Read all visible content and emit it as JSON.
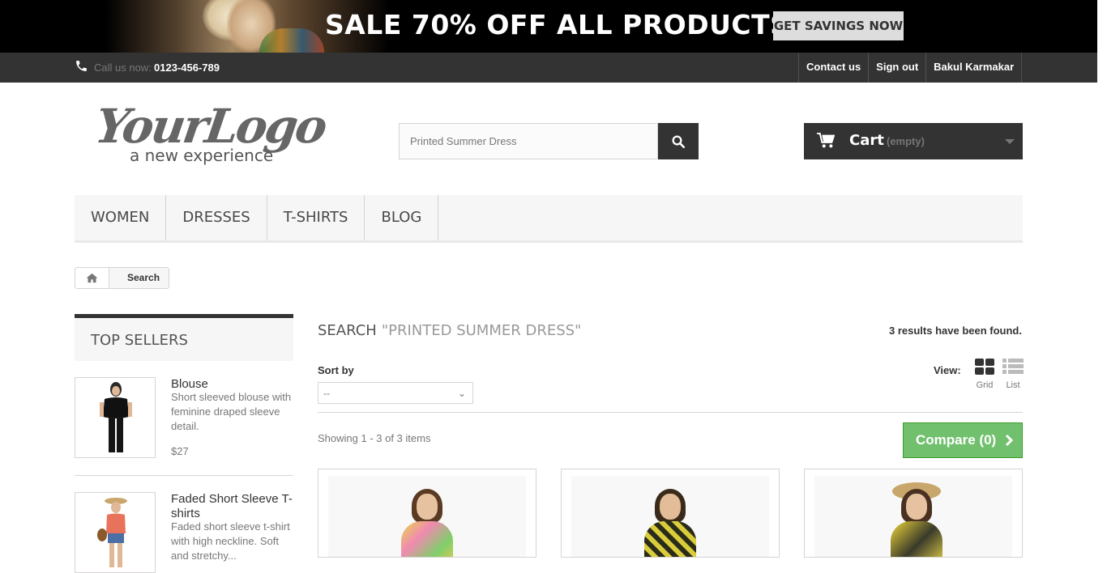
{
  "banner": {
    "headline": "SALE 70% OFF ALL PRODUCTS",
    "cta": "GET SAVINGS NOW"
  },
  "topbar": {
    "call_label": "Call us now:",
    "phone": "0123-456-789",
    "links": [
      "Contact us",
      "Sign out",
      "Bakul Karmakar"
    ]
  },
  "logo": {
    "main": "YourLogo",
    "tagline": "a new experience"
  },
  "search": {
    "value": "Printed Summer Dress"
  },
  "cart": {
    "label": "Cart",
    "status": "(empty)"
  },
  "menu": [
    "WOMEN",
    "DRESSES",
    "T-SHIRTS",
    "BLOG"
  ],
  "breadcrumb": {
    "current": "Search"
  },
  "sidebar": {
    "title": "TOP SELLERS",
    "items": [
      {
        "name": "Blouse",
        "description": "Short sleeved blouse with feminine draped sleeve detail.",
        "price": "$27"
      },
      {
        "name": "Faded Short Sleeve T-shirts",
        "description": "Faded short sleeve t-shirt with high neckline. Soft and stretchy..."
      }
    ]
  },
  "results": {
    "heading": "SEARCH",
    "query": "\"PRINTED SUMMER DRESS\"",
    "count": "3 results have been found.",
    "sort_label": "Sort by",
    "sort_value": "--",
    "view_label": "View:",
    "view_grid": "Grid",
    "view_list": "List",
    "showing": "Showing 1 - 3 of 3 items",
    "compare": "Compare (0)"
  },
  "colors": {
    "banner_bg": "#000000",
    "topbar_bg": "#333333",
    "dark_button": "#333333",
    "compare_green": "#71c06e",
    "menu_bg": "#f6f6f6"
  },
  "icons": {
    "phone": "phone-icon",
    "search": "search-icon",
    "cart": "cart-icon",
    "home": "home-icon",
    "grid": "grid-view-icon",
    "list": "list-view-icon",
    "compare": "chevron-right-icon"
  }
}
